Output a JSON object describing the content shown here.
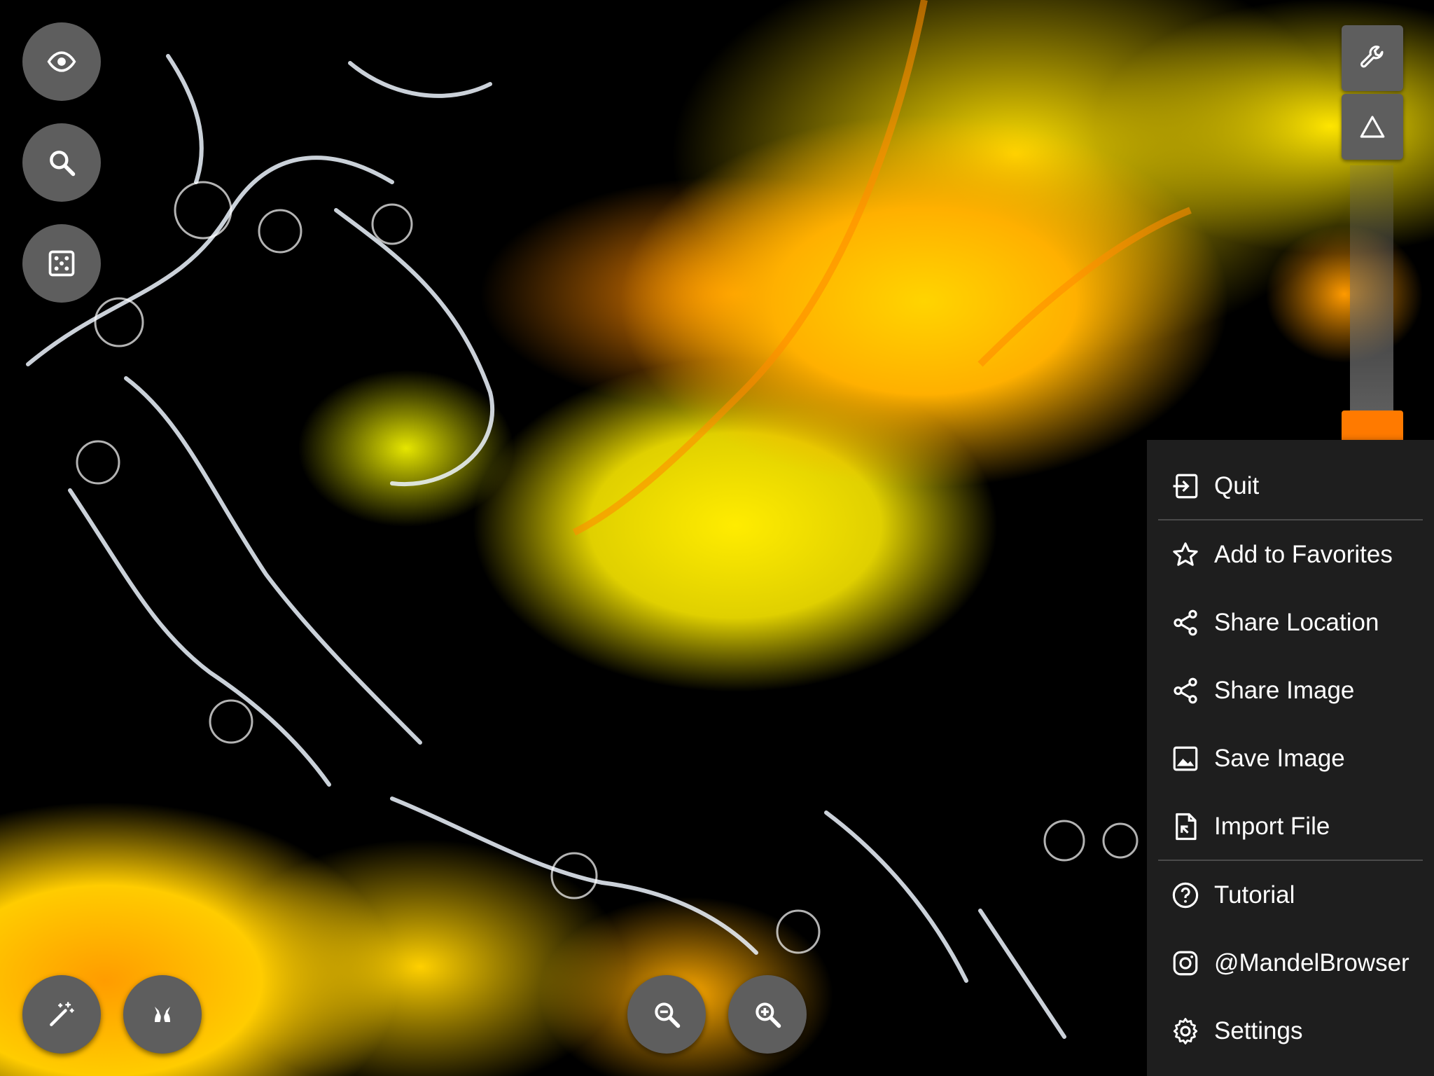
{
  "left_toolbar": {
    "eye_button": {
      "icon": "eye-icon"
    },
    "search_button": {
      "icon": "search-icon"
    },
    "random_button": {
      "icon": "dice-icon"
    }
  },
  "bottom_toolbar": {
    "magic_button": {
      "icon": "magic-wand-icon"
    },
    "gallery_button": {
      "icon": "bunny-icon"
    },
    "zoom_out_button": {
      "icon": "zoom-out-icon"
    },
    "zoom_in_button": {
      "icon": "zoom-in-icon"
    }
  },
  "right_toolbar": {
    "tools_button": {
      "icon": "wrench-icon"
    },
    "toggle_button": {
      "icon": "triangle-icon"
    },
    "slider": {
      "accent": "#ff7a00"
    }
  },
  "menu": {
    "items": [
      {
        "label": "Quit",
        "icon": "exit-icon"
      },
      {
        "label": "Add to Favorites",
        "icon": "star-icon"
      },
      {
        "label": "Share Location",
        "icon": "share-icon"
      },
      {
        "label": "Share Image",
        "icon": "share-icon"
      },
      {
        "label": "Save Image",
        "icon": "image-icon"
      },
      {
        "label": "Import File",
        "icon": "file-import-icon"
      },
      {
        "label": "Tutorial",
        "icon": "help-icon"
      },
      {
        "label": "@MandelBrowser",
        "icon": "instagram-icon"
      },
      {
        "label": "Settings",
        "icon": "gear-icon"
      }
    ]
  },
  "colors": {
    "button_bg": "#5e5e5e",
    "menu_bg": "#1e1e1e",
    "accent": "#ff7a00",
    "fractal_primary": "#ffd400"
  }
}
